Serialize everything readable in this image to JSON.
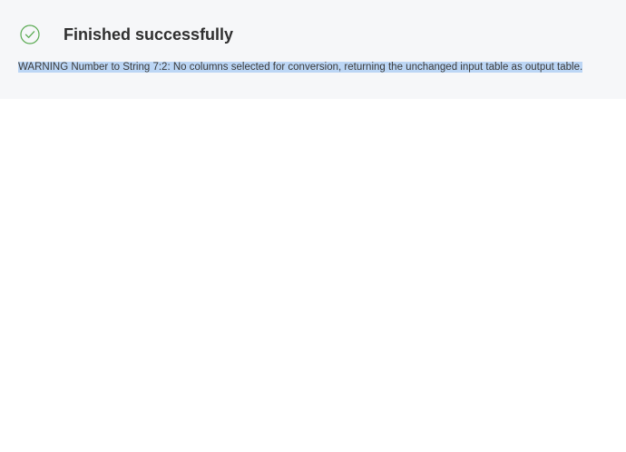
{
  "status": {
    "icon": "check-circle-icon",
    "icon_color": "#5aaa52",
    "title": "Finished successfully"
  },
  "message": {
    "text": "WARNING Number to String 7:2: No columns selected for conversion, returning the unchanged input table as output table.",
    "selected": true,
    "highlight_color": "#bcd6f5"
  },
  "colors": {
    "panel_background": "#f6f7f9",
    "page_background": "#ffffff",
    "title_text": "#2f2f2f"
  }
}
